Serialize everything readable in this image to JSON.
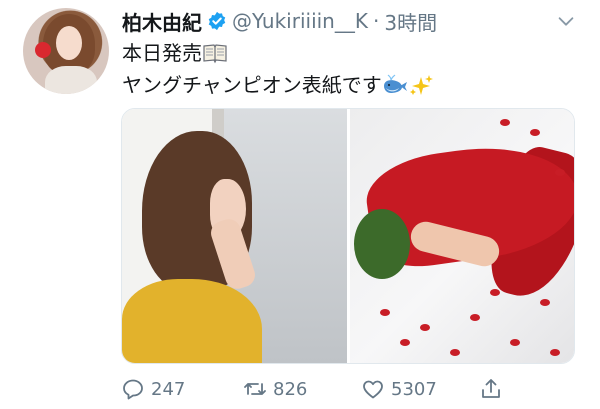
{
  "tweet": {
    "display_name": "柏木由紀",
    "handle": "@Yukiriiiin__K",
    "separator": "·",
    "time": "3時間",
    "text_line1": "本日発売",
    "text_line2": "ヤングチャンピオン表紙です",
    "emojis": [
      "open-book-emoji",
      "whale-emoji",
      "sparkles-emoji"
    ]
  },
  "media": {
    "photos": [
      "photo-yellow-sweater",
      "photo-red-dress-roses"
    ]
  },
  "actions": {
    "replies": "247",
    "retweets": "826",
    "likes": "5307"
  },
  "colors": {
    "text": "#14171a",
    "secondary": "#657786",
    "verified": "#1da1f2"
  }
}
